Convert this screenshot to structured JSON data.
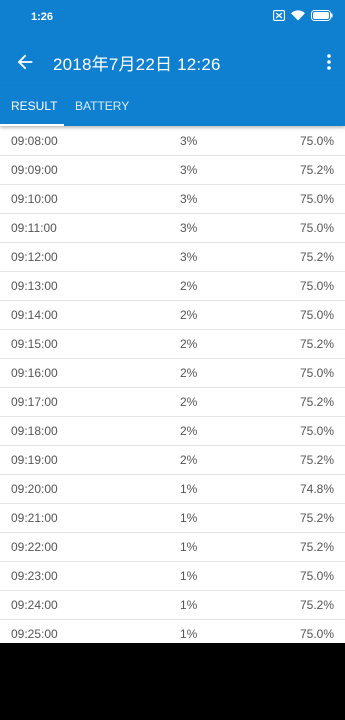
{
  "status_bar": {
    "time": "1:26"
  },
  "app_bar": {
    "title": "2018年7月22日 12:26"
  },
  "tabs": [
    {
      "label": "RESULT",
      "active": true
    },
    {
      "label": "BATTERY",
      "active": false
    }
  ],
  "rows": [
    {
      "time": "09:08:00",
      "percent": "3%",
      "value": "75.0%"
    },
    {
      "time": "09:09:00",
      "percent": "3%",
      "value": "75.2%"
    },
    {
      "time": "09:10:00",
      "percent": "3%",
      "value": "75.0%"
    },
    {
      "time": "09:11:00",
      "percent": "3%",
      "value": "75.0%"
    },
    {
      "time": "09:12:00",
      "percent": "3%",
      "value": "75.2%"
    },
    {
      "time": "09:13:00",
      "percent": "2%",
      "value": "75.0%"
    },
    {
      "time": "09:14:00",
      "percent": "2%",
      "value": "75.0%"
    },
    {
      "time": "09:15:00",
      "percent": "2%",
      "value": "75.2%"
    },
    {
      "time": "09:16:00",
      "percent": "2%",
      "value": "75.0%"
    },
    {
      "time": "09:17:00",
      "percent": "2%",
      "value": "75.2%"
    },
    {
      "time": "09:18:00",
      "percent": "2%",
      "value": "75.0%"
    },
    {
      "time": "09:19:00",
      "percent": "2%",
      "value": "75.2%"
    },
    {
      "time": "09:20:00",
      "percent": "1%",
      "value": "74.8%"
    },
    {
      "time": "09:21:00",
      "percent": "1%",
      "value": "75.2%"
    },
    {
      "time": "09:22:00",
      "percent": "1%",
      "value": "75.2%"
    },
    {
      "time": "09:23:00",
      "percent": "1%",
      "value": "75.0%"
    },
    {
      "time": "09:24:00",
      "percent": "1%",
      "value": "75.2%"
    },
    {
      "time": "09:25:00",
      "percent": "1%",
      "value": "75.0%"
    }
  ],
  "colors": {
    "primary": "#0f7fd0",
    "divider": "#e3e3e3",
    "text": "#555555"
  },
  "icons": [
    "back-arrow-icon",
    "overflow-menu-icon",
    "sim-icon",
    "wifi-icon",
    "battery-icon"
  ]
}
